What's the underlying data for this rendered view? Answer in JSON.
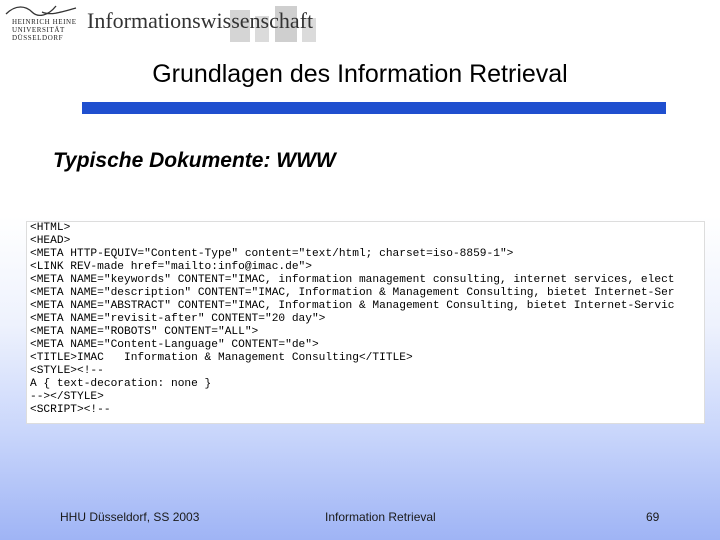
{
  "header": {
    "logo_lines": [
      "HEINRICH HEINE",
      "UNIVERSITÄT",
      "DÜSSELDORF"
    ],
    "institute": "Informationswissenschaft"
  },
  "slide": {
    "title": "Grundlagen des Information Retrieval",
    "subtitle": "Typische Dokumente: WWW",
    "rule_color": "#1f4fcf"
  },
  "code_lines": [
    "<HTML>",
    "<HEAD>",
    "<META HTTP-EQUIV=\"Content-Type\" content=\"text/html; charset=iso-8859-1\">",
    "<LINK REV-made href=\"mailto:info@imac.de\">",
    "<META NAME=\"keywords\" CONTENT=\"IMAC, information management consulting, internet services, elect",
    "<META NAME=\"description\" CONTENT=\"IMAC, Information & Management Consulting, bietet Internet-Ser",
    "<META NAME=\"ABSTRACT\" CONTENT=\"IMAC, Information & Management Consulting, bietet Internet-Servic",
    "<META NAME=\"revisit-after\" CONTENT=\"20 day\">",
    "<META NAME=\"ROBOTS\" CONTENT=\"ALL\">",
    "<META NAME=\"Content-Language\" CONTENT=\"de\">",
    "<TITLE>IMAC   Information & Management Consulting</TITLE>",
    "<STYLE><!--",
    "A { text-decoration: none }",
    "--></STYLE>",
    "<SCRIPT><!--"
  ],
  "footer": {
    "left": "HHU Düsseldorf, SS 2003",
    "center": "Information Retrieval",
    "page": "69"
  }
}
